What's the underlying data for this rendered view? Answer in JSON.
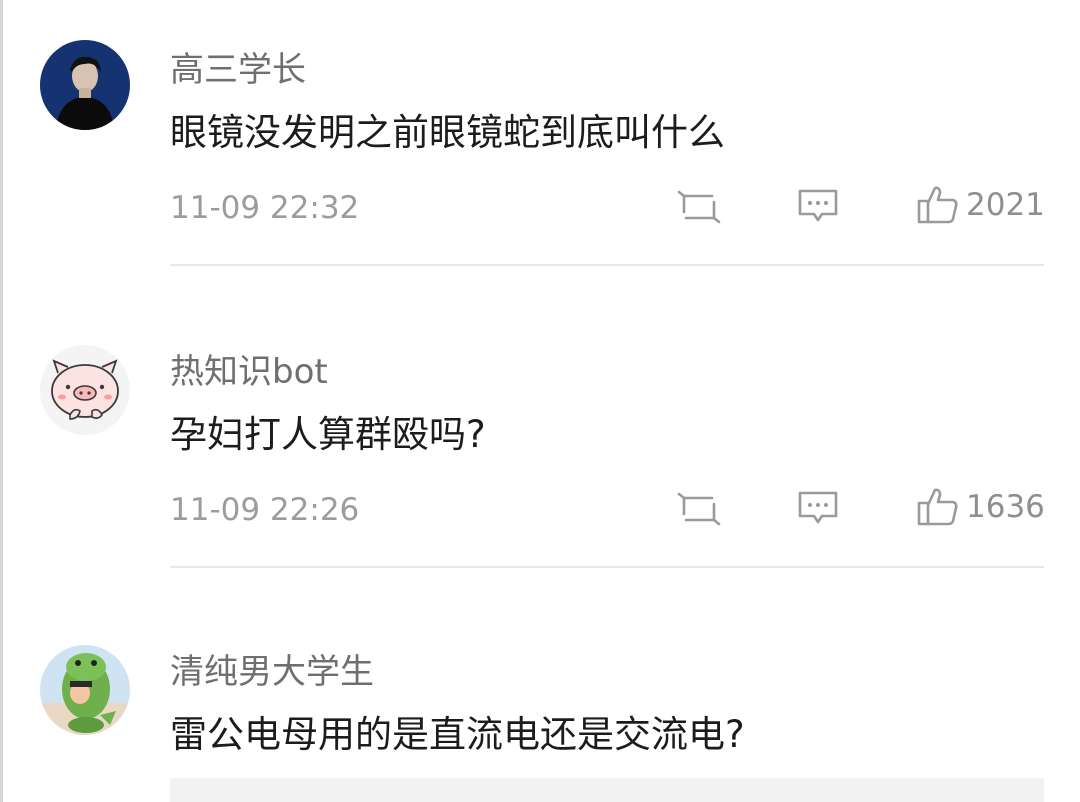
{
  "comments": [
    {
      "username": "高三学长",
      "text": "眼镜没发明之前眼镜蛇到底叫什么",
      "timestamp": "11-09 22:32",
      "likes": "2021",
      "avatar": "person-photo-avatar"
    },
    {
      "username": "热知识bot",
      "text": "孕妇打人算群殴吗?",
      "timestamp": "11-09 22:26",
      "likes": "1636",
      "avatar": "pig-cartoon-avatar"
    },
    {
      "username": "清纯男大学生",
      "text": "雷公电母用的是直流电还是交流电?",
      "avatar": "dinosaur-costume-cartoon-avatar"
    }
  ],
  "icons": {
    "repost": "repost-icon",
    "reply": "comment-icon",
    "like": "thumbs-up-icon"
  },
  "colors": {
    "username": "#6f6f6f",
    "text": "#1c1c1c",
    "meta": "#9c9c9c",
    "divider": "#e8e8e8"
  }
}
